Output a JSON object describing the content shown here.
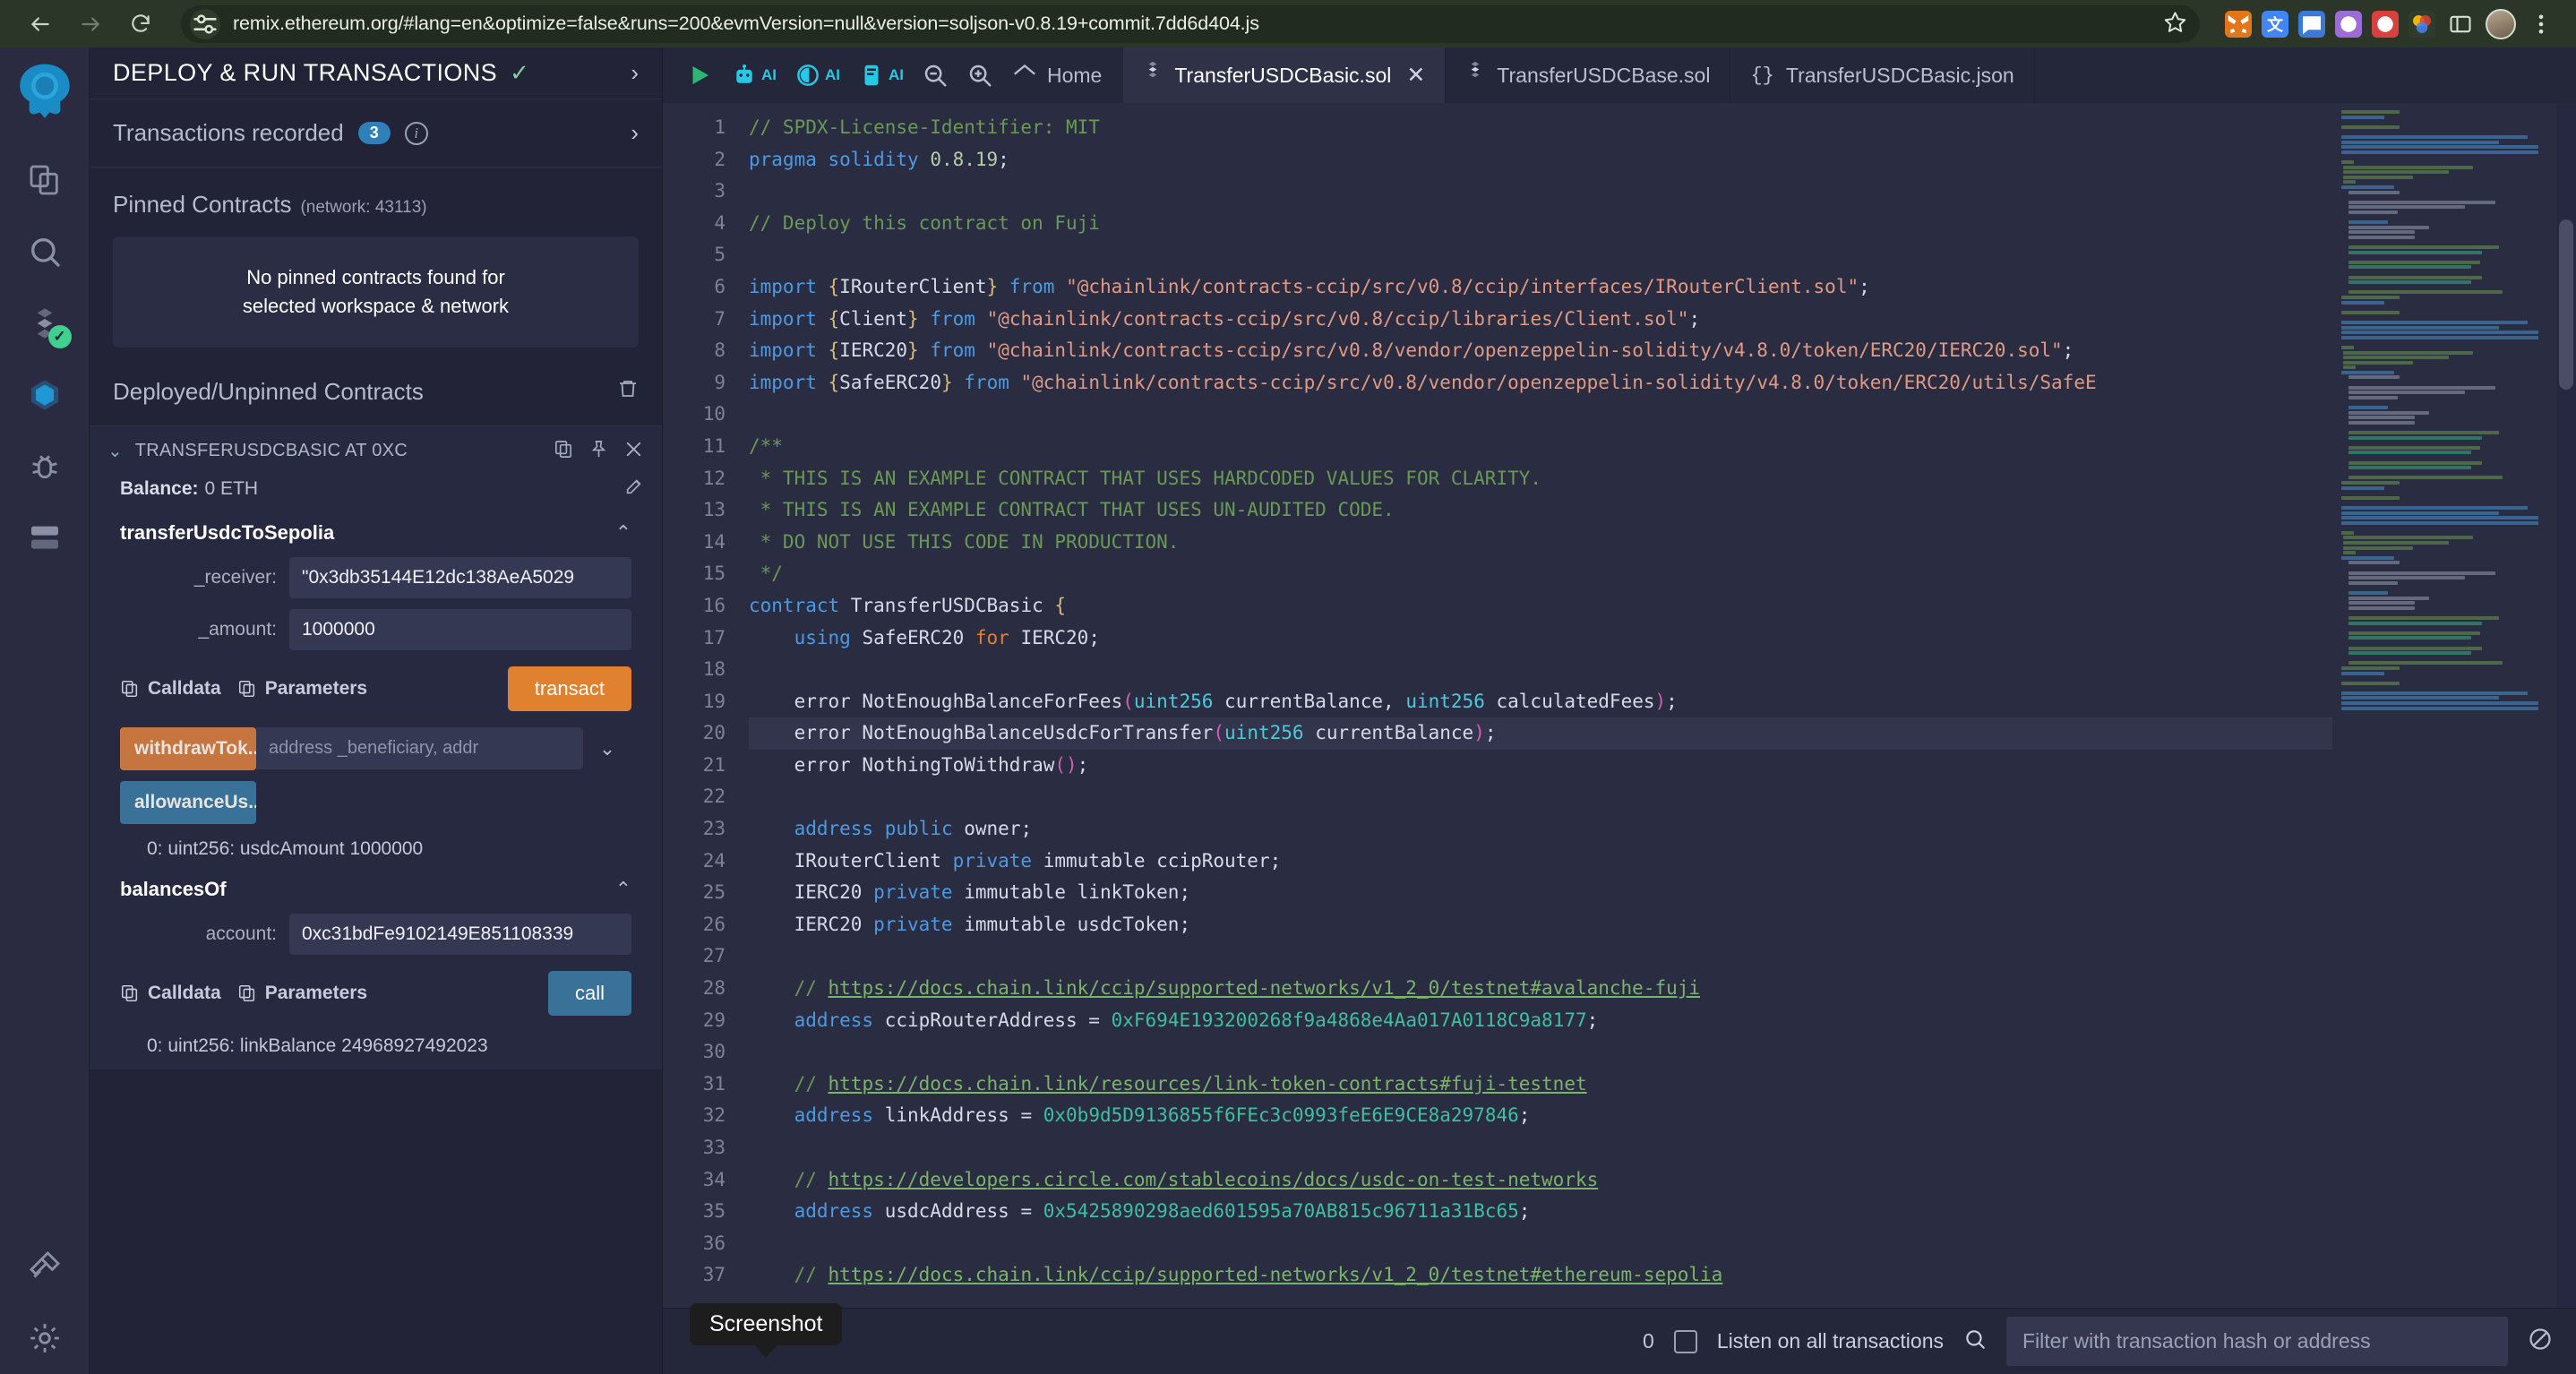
{
  "browser": {
    "url": "remix.ethereum.org/#lang=en&optimize=false&runs=200&evmVersion=null&version=soljson-v0.8.19+commit.7dd6d404.js",
    "back_label": "Back",
    "forward_label": "Forward",
    "reload_label": "Reload",
    "bookmark_label": "Bookmark this tab"
  },
  "rail": {
    "items": [
      {
        "name": "file-explorer-icon",
        "label": "File explorer"
      },
      {
        "name": "search-icon",
        "label": "Search in files"
      },
      {
        "name": "solidity-compiler-icon",
        "label": "Solidity compiler"
      },
      {
        "name": "deploy-run-icon",
        "label": "Deploy & run transactions"
      },
      {
        "name": "debugger-icon",
        "label": "Debugger"
      },
      {
        "name": "plugin-manager-icon",
        "label": "Plugin manager"
      },
      {
        "name": "plugin-extra-icon",
        "label": "Plugins"
      },
      {
        "name": "settings-icon",
        "label": "Settings"
      }
    ]
  },
  "panel": {
    "title": "DEPLOY & RUN TRANSACTIONS",
    "transactions_recorded_label": "Transactions recorded",
    "transactions_recorded_count": "3",
    "pinned_contracts_label": "Pinned Contracts",
    "pinned_contracts_network": "(network: 43113)",
    "pinned_empty_line1": "No pinned contracts found for",
    "pinned_empty_line2": "selected workspace & network",
    "deployed_label": "Deployed/Unpinned Contracts",
    "contract": {
      "name": "TRANSFERUSDCBASIC AT 0XC",
      "balance_label": "Balance:",
      "balance_value": "0 ETH",
      "functions": [
        {
          "name": "transferUsdcToSepolia",
          "fields": [
            {
              "label": "_receiver:",
              "value": "\"0x3db35144E12dc138AeA5029"
            },
            {
              "label": "_amount:",
              "value": "1000000"
            }
          ],
          "calldata_label": "Calldata",
          "parameters_label": "Parameters",
          "action_label": "transact"
        }
      ],
      "inline_functions": [
        {
          "label": "withdrawTok...",
          "placeholder": "address _beneficiary, addr",
          "style": "orange"
        },
        {
          "label": "allowanceUs...",
          "placeholder": "",
          "style": "blue"
        }
      ],
      "results": [
        "0: uint256: usdcAmount 1000000"
      ],
      "second_function": {
        "name": "balancesOf",
        "fields": [
          {
            "label": "account:",
            "value": "0xc31bdFe9102149E851108339"
          }
        ],
        "calldata_label": "Calldata",
        "parameters_label": "Parameters",
        "action_label": "call",
        "result": "0: uint256: linkBalance 24968927492023"
      }
    }
  },
  "editor": {
    "toolbar": [
      {
        "name": "run-script-icon",
        "label": "Run script"
      },
      {
        "name": "robot-ai-icon",
        "label": "AI"
      },
      {
        "name": "eye-ai-icon",
        "label": "AI"
      },
      {
        "name": "copilot-ai-icon",
        "label": "AI"
      },
      {
        "name": "zoom-out-icon",
        "label": "Zoom out"
      },
      {
        "name": "zoom-in-icon",
        "label": "Zoom in"
      },
      {
        "name": "home-icon",
        "label": "Home"
      }
    ],
    "home_label": "Home",
    "tabs": [
      {
        "label": "TransferUSDCBasic.sol",
        "icon": "solidity-icon",
        "active": true,
        "closable": true
      },
      {
        "label": "TransferUSDCBase.sol",
        "icon": "solidity-icon",
        "active": false,
        "closable": false
      },
      {
        "label": "TransferUSDCBasic.json",
        "icon": "json-icon",
        "active": false,
        "closable": false
      }
    ],
    "active_line": 20,
    "first_line": 1,
    "lines": [
      {
        "n": 1,
        "html": "<span class='cmt'>// SPDX-License-Identifier: MIT</span>"
      },
      {
        "n": 2,
        "html": "<span class='kw'>pragma solidity</span> <span class='num'>0.8.19</span>;"
      },
      {
        "n": 3,
        "html": ""
      },
      {
        "n": 4,
        "html": "<span class='cmt'>// Deploy this contract on Fuji</span>"
      },
      {
        "n": 5,
        "html": ""
      },
      {
        "n": 6,
        "html": "<span class='kw'>import</span> <span class='brc'>{</span>IRouterClient<span class='brc'>}</span> <span class='kw'>from</span> <span class='str'>\"@chainlink/contracts-ccip/src/v0.8/ccip/interfaces/IRouterClient.sol\"</span>;"
      },
      {
        "n": 7,
        "html": "<span class='kw'>import</span> <span class='brc'>{</span>Client<span class='brc'>}</span> <span class='kw'>from</span> <span class='str'>\"@chainlink/contracts-ccip/src/v0.8/ccip/libraries/Client.sol\"</span>;"
      },
      {
        "n": 8,
        "html": "<span class='kw'>import</span> <span class='brc'>{</span>IERC20<span class='brc'>}</span> <span class='kw'>from</span> <span class='str'>\"@chainlink/contracts-ccip/src/v0.8/vendor/openzeppelin-solidity/v4.8.0/token/ERC20/IERC20.sol\"</span>;"
      },
      {
        "n": 9,
        "html": "<span class='kw'>import</span> <span class='brc'>{</span>SafeERC20<span class='brc'>}</span> <span class='kw'>from</span> <span class='str'>\"@chainlink/contracts-ccip/src/v0.8/vendor/openzeppelin-solidity/v4.8.0/token/ERC20/utils/SafeE</span>"
      },
      {
        "n": 10,
        "html": ""
      },
      {
        "n": 11,
        "html": "<span class='cmt'>/**</span>"
      },
      {
        "n": 12,
        "html": "<span class='cmt'> * THIS IS AN EXAMPLE CONTRACT THAT USES HARDCODED VALUES FOR CLARITY.</span>"
      },
      {
        "n": 13,
        "html": "<span class='cmt'> * THIS IS AN EXAMPLE CONTRACT THAT USES UN-AUDITED CODE.</span>"
      },
      {
        "n": 14,
        "html": "<span class='cmt'> * DO NOT USE THIS CODE IN PRODUCTION.</span>"
      },
      {
        "n": 15,
        "html": "<span class='cmt'> */</span>"
      },
      {
        "n": 16,
        "html": "<span class='kw'>contract</span> TransferUSDCBasic <span class='brc'>{</span>"
      },
      {
        "n": 17,
        "html": "    <span class='kw'>using</span> SafeERC20 <span class='kw2'>for</span> IERC20;"
      },
      {
        "n": 18,
        "html": ""
      },
      {
        "n": 19,
        "html": "    error NotEnoughBalanceForFees<span class='pnk'>(</span><span class='typ'>uint256</span> currentBalance, <span class='typ'>uint256</span> calculatedFees<span class='pnk'>)</span>;"
      },
      {
        "n": 20,
        "html": "    error NotEnoughBalanceUsdcForTransfer<span class='pnk'>(</span><span class='typ'>uint256</span> currentBalance<span class='pnk'>)</span>;"
      },
      {
        "n": 21,
        "html": "    error NothingToWithdraw<span class='pnk'>()</span>;"
      },
      {
        "n": 22,
        "html": ""
      },
      {
        "n": 23,
        "html": "    <span class='kw'>address</span> <span class='kw'>public</span> owner;"
      },
      {
        "n": 24,
        "html": "    IRouterClient <span class='kw'>private</span> immutable ccipRouter;"
      },
      {
        "n": 25,
        "html": "    IERC20 <span class='kw'>private</span> immutable linkToken;"
      },
      {
        "n": 26,
        "html": "    IERC20 <span class='kw'>private</span> immutable usdcToken;"
      },
      {
        "n": 27,
        "html": ""
      },
      {
        "n": 28,
        "html": "    <span class='cmt'>// </span><span class='lnk'>https://docs.chain.link/ccip/supported-networks/v1_2_0/testnet#avalanche-fuji</span>"
      },
      {
        "n": 29,
        "html": "    <span class='kw'>address</span> ccipRouterAddress = <span class='hex'>0xF694E193200268f9a4868e4Aa017A0118C9a8177</span>;"
      },
      {
        "n": 30,
        "html": ""
      },
      {
        "n": 31,
        "html": "    <span class='cmt'>// </span><span class='lnk'>https://docs.chain.link/resources/link-token-contracts#fuji-testnet</span>"
      },
      {
        "n": 32,
        "html": "    <span class='kw'>address</span> linkAddress = <span class='hex'>0x0b9d5D9136855f6FEc3c0993feE6E9CE8a297846</span>;"
      },
      {
        "n": 33,
        "html": ""
      },
      {
        "n": 34,
        "html": "    <span class='cmt'>// </span><span class='lnk'>https://developers.circle.com/stablecoins/docs/usdc-on-test-networks</span>"
      },
      {
        "n": 35,
        "html": "    <span class='kw'>address</span> usdcAddress = <span class='hex'>0x5425890298aed601595a70AB815c96711a31Bc65</span>;"
      },
      {
        "n": 36,
        "html": ""
      },
      {
        "n": 37,
        "html": "    <span class='cmt'>// </span><span class='lnk'>https://docs.chain.link/ccip/supported-networks/v1_2_0/testnet#ethereum-sepolia</span>"
      }
    ]
  },
  "statusbar": {
    "count": "0",
    "listen_label": "Listen on all transactions",
    "filter_placeholder": "Filter with transaction hash or address",
    "search_icon": "search-icon",
    "clear_icon": "ban-icon"
  },
  "tooltip": {
    "text": "Screenshot"
  },
  "colors": {
    "accent_orange": "#e08130",
    "accent_blue": "#3a7199",
    "accent_orange_dim": "#c6753e",
    "panel_bg": "#222336",
    "editor_bg": "#2a2c42",
    "browser_bg": "#2b3628",
    "success_green": "#3fcf8e"
  }
}
